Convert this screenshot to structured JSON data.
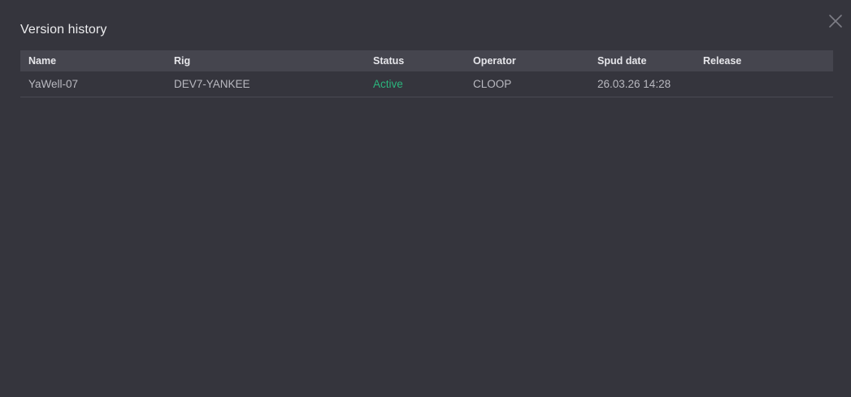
{
  "dialog": {
    "title": "Version history",
    "close_icon": "close-icon"
  },
  "table": {
    "columns": [
      {
        "key": "name",
        "label": "Name"
      },
      {
        "key": "rig",
        "label": "Rig"
      },
      {
        "key": "status",
        "label": "Status"
      },
      {
        "key": "operator",
        "label": "Operator"
      },
      {
        "key": "spud_date",
        "label": "Spud date"
      },
      {
        "key": "release",
        "label": "Release"
      }
    ],
    "rows": [
      {
        "name": "YaWell-07",
        "rig": "DEV7-YANKEE",
        "status": "Active",
        "operator": "CLOOP",
        "spud_date": "26.03.26 14:28",
        "release": ""
      }
    ]
  },
  "colors": {
    "background": "#35353d",
    "header_bg": "#45454e",
    "status_active": "#2bb57d",
    "divider": "#4a4a53"
  }
}
